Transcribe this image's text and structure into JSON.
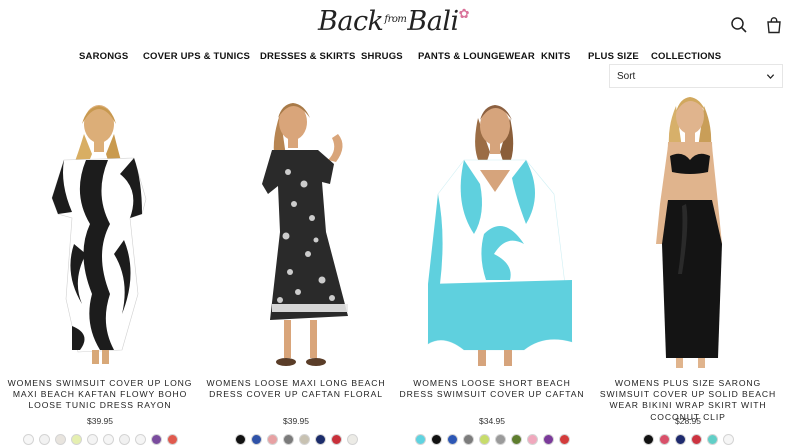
{
  "brand": {
    "logo_main": "Back",
    "logo_from": "from",
    "logo_end": "Bali",
    "logo_flower": "✿"
  },
  "header": {
    "search_icon": "search-icon",
    "cart_icon": "cart-icon"
  },
  "nav": {
    "items": [
      {
        "label": "SARONGS"
      },
      {
        "label": "COVER UPS & TUNICS"
      },
      {
        "label": "DRESSES & SKIRTS"
      },
      {
        "label": "SHRUGS"
      },
      {
        "label": "PANTS & LOUNGEWEAR"
      },
      {
        "label": "KNITS"
      },
      {
        "label": "PLUS SIZE"
      },
      {
        "label": "COLLECTIONS"
      }
    ]
  },
  "sort": {
    "label": "Sort",
    "icon": "chevron-down-icon"
  },
  "products": [
    {
      "title": "WOMENS SWIMSUIT COVER UP LONG MAXI BEACH KAFTAN FLOWY BOHO LOOSE TUNIC DRESS RAYON",
      "price": "$39.95",
      "swatches": [
        "#f7f7f7",
        "#f2f2f2",
        "#e8e4de",
        "#e5efb0",
        "#f4f4f4",
        "#f6f6f6",
        "#f1f1f1",
        "#f5f5f5",
        "#7a4c9e",
        "#e05a4e"
      ]
    },
    {
      "title": "WOMENS LOOSE MAXI LONG BEACH DRESS COVER UP CAFTAN FLORAL",
      "price": "$39.95",
      "swatches": [
        "#111111",
        "#2f52a8",
        "#e7a1a3",
        "#7b7b7b",
        "#c8c2b2",
        "#1b2c6b",
        "#c8303a",
        "#ecebe6"
      ]
    },
    {
      "title": "WOMENS LOOSE SHORT BEACH DRESS SWIMSUIT COVER UP CAFTAN",
      "price": "$34.95",
      "swatches": [
        "#5fd3e0",
        "#111111",
        "#2d57b5",
        "#7c7c7c",
        "#c7dc6b",
        "#9a9a9a",
        "#5e7d2e",
        "#f0a8bd",
        "#7b3a9a",
        "#d33b3b"
      ]
    },
    {
      "title": "WOMENS PLUS SIZE SARONG SWIMSUIT COVER UP SOLID BEACH WEAR BIKINI WRAP SKIRT WITH COCONUT CLIP",
      "price": "$28.95",
      "swatches": [
        "#111111",
        "#d9506a",
        "#1e2a6e",
        "#cc3340",
        "#61cfc7",
        "#f6f6f6"
      ]
    }
  ]
}
